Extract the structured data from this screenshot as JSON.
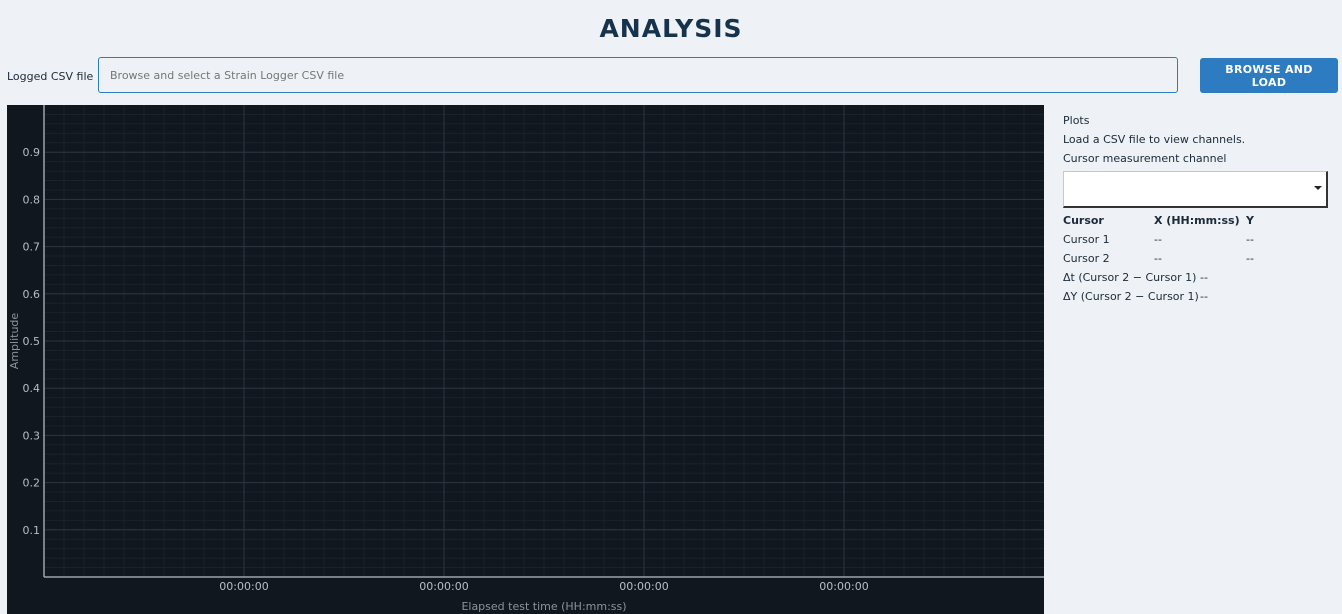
{
  "header": {
    "title": "ANALYSIS"
  },
  "file": {
    "label": "Logged CSV file",
    "placeholder": "Browse and select a Strain Logger CSV file",
    "browse_label": "BROWSE AND LOAD"
  },
  "chart_data": {
    "type": "line",
    "title": "",
    "xlabel": "Elapsed test time (HH:mm:ss)",
    "ylabel": "Amplitude",
    "ylim": [
      0,
      1
    ],
    "yticks": [
      0.1,
      0.2,
      0.3,
      0.4,
      0.5,
      0.6,
      0.7,
      0.8,
      0.9
    ],
    "xticks": [
      "00:00:00",
      "00:00:00",
      "00:00:00",
      "00:00:00"
    ],
    "series": [],
    "grid": true
  },
  "side": {
    "plots_heading": "Plots",
    "plots_message": "Load a CSV file to view channels.",
    "cursor_channel_label": "Cursor measurement channel",
    "cursor_channel_value": "",
    "table": {
      "headers": [
        "Cursor",
        "X (HH:mm:ss)",
        "Y"
      ],
      "rows": [
        {
          "name": "Cursor 1",
          "x": "--",
          "y": "--"
        },
        {
          "name": "Cursor 2",
          "x": "--",
          "y": "--"
        }
      ],
      "delta_t_label": "Δt (Cursor 2 − Cursor 1)",
      "delta_t_value": "--",
      "delta_y_label": "ΔY (Cursor 2 − Cursor 1)",
      "delta_y_value": "--"
    }
  },
  "colors": {
    "accent": "#2d7cc1",
    "plot_background": "#11171e",
    "grid_major": "#2c3540",
    "grid_minor": "#1a222b",
    "axis": "#9aa3ad",
    "tick_text": "#b6bdc5"
  }
}
